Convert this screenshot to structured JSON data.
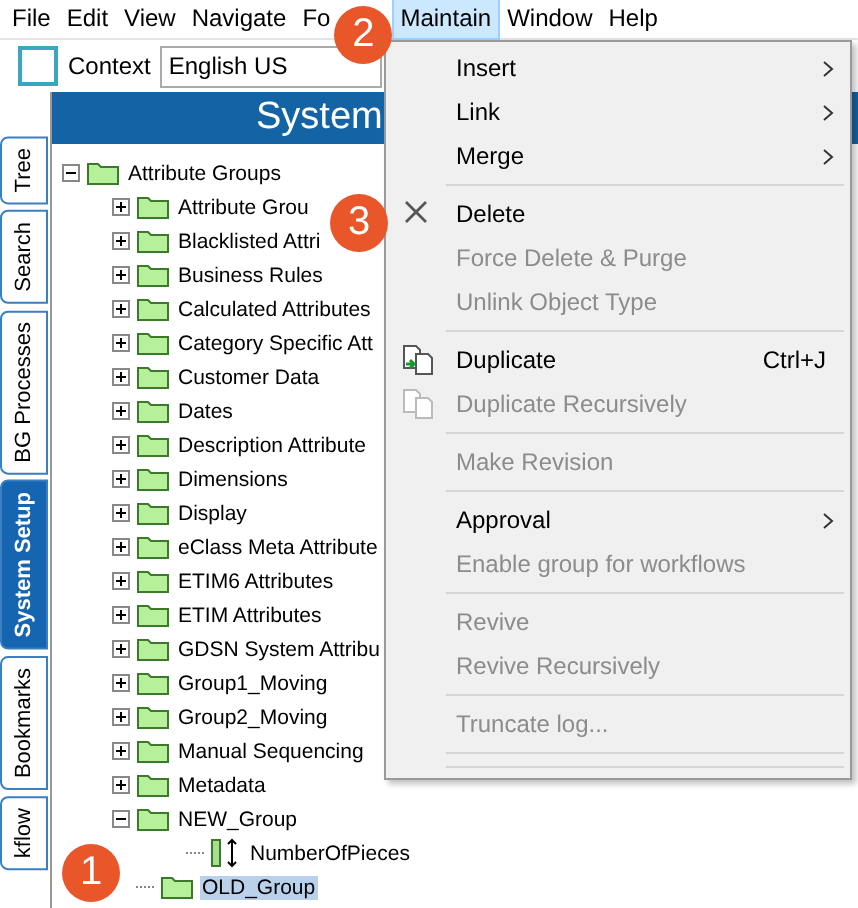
{
  "menu_bar": [
    {
      "label": "File",
      "selected": false
    },
    {
      "label": "Edit",
      "selected": false
    },
    {
      "label": "View",
      "selected": false
    },
    {
      "label": "Navigate",
      "selected": false
    },
    {
      "label": "Fo",
      "selected": false
    },
    {
      "label": "Maintain",
      "selected": true
    },
    {
      "label": "Window",
      "selected": false
    },
    {
      "label": "Help",
      "selected": false
    }
  ],
  "context": {
    "label": "Context",
    "value": "English US",
    "checked": false
  },
  "side_tabs": [
    {
      "label": "Tree",
      "selected": false
    },
    {
      "label": "Search",
      "selected": false
    },
    {
      "label": "BG Processes",
      "selected": false
    },
    {
      "label": "System Setup",
      "selected": true
    },
    {
      "label": "Bookmarks",
      "selected": false
    },
    {
      "label": "kflow",
      "selected": false
    }
  ],
  "panel": {
    "title": "System"
  },
  "tree": [
    {
      "label": "Attribute Groups",
      "expanded": true,
      "selected": false,
      "kind": "folder",
      "children": [
        {
          "label": "Attribute Grou",
          "expanded": false,
          "selected": false,
          "kind": "folder"
        },
        {
          "label": "Blacklisted Attri",
          "expanded": false,
          "selected": false,
          "kind": "folder"
        },
        {
          "label": "Business Rules",
          "expanded": false,
          "selected": false,
          "kind": "folder"
        },
        {
          "label": "Calculated Attributes",
          "expanded": false,
          "selected": false,
          "kind": "folder"
        },
        {
          "label": "Category Specific Att",
          "expanded": false,
          "selected": false,
          "kind": "folder"
        },
        {
          "label": "Customer Data",
          "expanded": false,
          "selected": false,
          "kind": "folder"
        },
        {
          "label": "Dates",
          "expanded": false,
          "selected": false,
          "kind": "folder"
        },
        {
          "label": "Description Attribute",
          "expanded": false,
          "selected": false,
          "kind": "folder"
        },
        {
          "label": "Dimensions",
          "expanded": false,
          "selected": false,
          "kind": "folder"
        },
        {
          "label": "Display",
          "expanded": false,
          "selected": false,
          "kind": "folder"
        },
        {
          "label": "eClass Meta Attribute",
          "expanded": false,
          "selected": false,
          "kind": "folder"
        },
        {
          "label": "ETIM6 Attributes",
          "expanded": false,
          "selected": false,
          "kind": "folder"
        },
        {
          "label": "ETIM Attributes",
          "expanded": false,
          "selected": false,
          "kind": "folder"
        },
        {
          "label": "GDSN System Attribu",
          "expanded": false,
          "selected": false,
          "kind": "folder"
        },
        {
          "label": "Group1_Moving",
          "expanded": false,
          "selected": false,
          "kind": "folder"
        },
        {
          "label": "Group2_Moving",
          "expanded": false,
          "selected": false,
          "kind": "folder"
        },
        {
          "label": "Manual Sequencing",
          "expanded": false,
          "selected": false,
          "kind": "folder"
        },
        {
          "label": "Metadata",
          "expanded": false,
          "selected": false,
          "kind": "folder"
        },
        {
          "label": "NEW_Group",
          "expanded": true,
          "selected": false,
          "kind": "folder",
          "children": [
            {
              "label": "NumberOfPieces",
              "selected": false,
              "kind": "attribute"
            }
          ]
        },
        {
          "label": "OLD_Group",
          "selected": true,
          "kind": "folder"
        }
      ]
    }
  ],
  "menu": [
    {
      "kind": "item",
      "label": "Insert",
      "submenu": true,
      "disabled": false
    },
    {
      "kind": "item",
      "label": "Link",
      "submenu": true,
      "disabled": false
    },
    {
      "kind": "item",
      "label": "Merge",
      "submenu": true,
      "disabled": false
    },
    {
      "kind": "separator"
    },
    {
      "kind": "delete",
      "label": "Delete",
      "disabled": false
    },
    {
      "kind": "item",
      "label": "Force Delete & Purge",
      "disabled": true
    },
    {
      "kind": "item",
      "label": "Unlink Object Type",
      "disabled": true
    },
    {
      "kind": "separator"
    },
    {
      "kind": "duplicate",
      "label": "Duplicate",
      "disabled": false,
      "shortcut": "Ctrl+J"
    },
    {
      "kind": "duplicate",
      "label": "Duplicate Recursively",
      "disabled": true
    },
    {
      "kind": "separator"
    },
    {
      "kind": "item",
      "label": "Make Revision",
      "disabled": true
    },
    {
      "kind": "separator"
    },
    {
      "kind": "item",
      "label": "Approval",
      "submenu": true,
      "disabled": false
    },
    {
      "kind": "item",
      "label": "Enable group for workflows",
      "disabled": true
    },
    {
      "kind": "separator"
    },
    {
      "kind": "item",
      "label": "Revive",
      "disabled": true
    },
    {
      "kind": "item",
      "label": "Revive Recursively",
      "disabled": true
    },
    {
      "kind": "separator"
    },
    {
      "kind": "item",
      "label": "Truncate log...",
      "disabled": true
    },
    {
      "kind": "separator"
    },
    {
      "kind": "separator"
    }
  ],
  "step_badges": [
    {
      "label": "1"
    },
    {
      "label": "2"
    },
    {
      "label": "3"
    }
  ]
}
